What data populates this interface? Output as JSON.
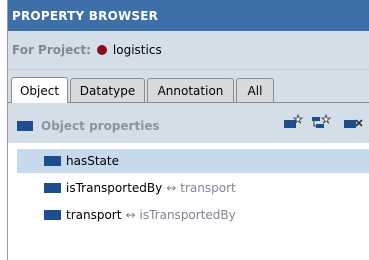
{
  "title": "PROPERTY BROWSER",
  "project": {
    "label": "For Project:",
    "name": "logistics"
  },
  "tabs": [
    {
      "label": "Object",
      "active": true
    },
    {
      "label": "Datatype"
    },
    {
      "label": "Annotation"
    },
    {
      "label": "All"
    }
  ],
  "section": {
    "label": "Object properties"
  },
  "properties": [
    {
      "name": "hasState",
      "inverse": "",
      "arrow": "",
      "selected": true
    },
    {
      "name": "isTransportedBy",
      "arrow": "↔",
      "inverse": "transport"
    },
    {
      "name": "transport",
      "arrow": "↔",
      "inverse": "isTransportedBy"
    }
  ],
  "colors": {
    "title_bg": "#3e6fa8",
    "panel_bg": "#d4dee9",
    "selected_row": "#c7d9ec",
    "property_icon": "#1f4e8f",
    "project_icon": "#8b0d1d"
  }
}
